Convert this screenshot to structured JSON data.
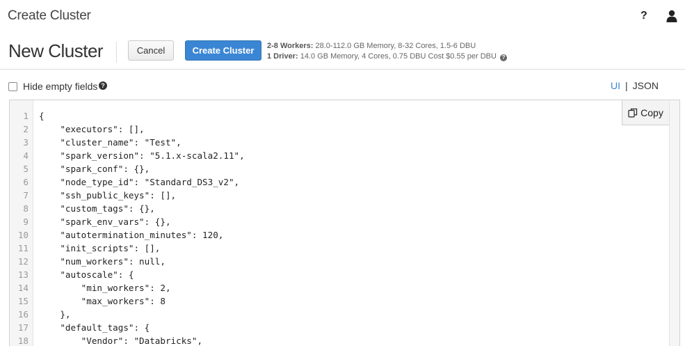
{
  "topbar": {
    "title": "Create Cluster",
    "help_glyph": "?",
    "icons": [
      "help-icon",
      "user-icon"
    ]
  },
  "header": {
    "cluster_name": "New Cluster",
    "cancel_label": "Cancel",
    "create_label": "Create Cluster",
    "workers_label": "2-8 Workers:",
    "workers_detail": " 28.0-112.0 GB Memory, 8-32 Cores, 1.5-6 DBU",
    "driver_label": "1 Driver:",
    "driver_detail": " 14.0 GB Memory, 4 Cores, 0.75 DBU Cost $0.55 per DBU",
    "cost_help_glyph": "?"
  },
  "options": {
    "hide_empty_label": "Hide empty fields",
    "hide_empty_checked": false,
    "info_glyph": "?",
    "view_ui": "UI",
    "view_sep": "|",
    "view_json": "JSON",
    "active_view": "UI"
  },
  "editor": {
    "copy_label": "Copy",
    "lines": [
      {
        "num": "1",
        "text": "{"
      },
      {
        "num": "2",
        "text": "    \"executors\": [],"
      },
      {
        "num": "3",
        "text": "    \"cluster_name\": \"Test\","
      },
      {
        "num": "4",
        "text": "    \"spark_version\": \"5.1.x-scala2.11\","
      },
      {
        "num": "5",
        "text": "    \"spark_conf\": {},"
      },
      {
        "num": "6",
        "text": "    \"node_type_id\": \"Standard_DS3_v2\","
      },
      {
        "num": "7",
        "text": "    \"ssh_public_keys\": [],"
      },
      {
        "num": "8",
        "text": "    \"custom_tags\": {},"
      },
      {
        "num": "9",
        "text": "    \"spark_env_vars\": {},"
      },
      {
        "num": "10",
        "text": "    \"autotermination_minutes\": 120,"
      },
      {
        "num": "11",
        "text": "    \"init_scripts\": [],"
      },
      {
        "num": "12",
        "text": "    \"num_workers\": null,"
      },
      {
        "num": "13",
        "text": "    \"autoscale\": {"
      },
      {
        "num": "14",
        "text": "        \"min_workers\": 2,"
      },
      {
        "num": "15",
        "text": "        \"max_workers\": 8"
      },
      {
        "num": "16",
        "text": "    },"
      },
      {
        "num": "17",
        "text": "    \"default_tags\": {"
      },
      {
        "num": "18",
        "text": "        \"Vendor\": \"Databricks\","
      }
    ]
  },
  "colors": {
    "accent": "#3b86d4",
    "text": "#333333",
    "gutter_text": "#999999"
  }
}
